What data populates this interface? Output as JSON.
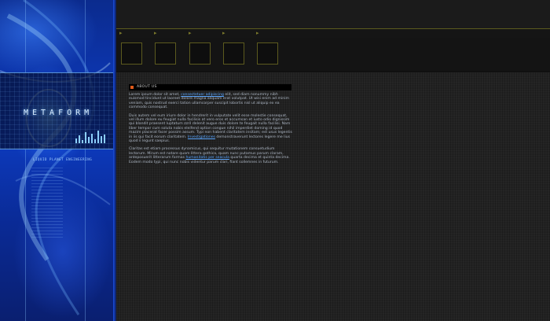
{
  "brand": {
    "logo_text": "METAFORM",
    "tagline": "LIQUID PLANET ENGINEERING"
  },
  "nav": {
    "arrow_count": 5
  },
  "thumbnails": {
    "count": 5
  },
  "section": {
    "title": "About us"
  },
  "content": {
    "p1_a": "Lorem ipsum dolor sit amet, ",
    "p1_link": "consectetuer adipiscing",
    "p1_b": " elit, sed diam nonummy nibh euismod tincidunt ut laoreet dolore magna aliquam erat volutpat. Ut wisi enim ad minim veniam, quis nostrud exerci tation ullamcorper suscipit lobortis nisl ut aliquip ex ea commodo consequat.",
    "p2_a": "Duis autem vel eum iriure dolor in hendrerit in vulputate velit esse molestie consequat, vel illum dolore eu feugiat nulla facilisis at vero eros et accumsan et iusto odio dignissim qui blandit praesent luptatum zzril delenit augue duis dolore te feugait nulla facilisi. Nam liber tempor cum soluta nobis eleifend option congue nihil imperdiet doming id quod mazim placerat facer possim assum. Typi non habent claritatem insitam; est usus legentis in iis qui facit eorum claritatem. ",
    "p2_link": "Investigationes",
    "p2_b": " demonstraverunt lectores legere me lius quod ii legunt saepius.",
    "p3_a": "Claritas est etiam processus dynamicus, qui sequitur mutationem consuetudium lectorum. Mirum est notare quam littera gothica, quam nunc putamus parum claram, anteposuerit litterarum formas ",
    "p3_link": "humanitatis per seacula",
    "p3_b": " quarta decima et quinta decima. Eodem modo typi, qui nunc nobis videntur parum clari, fiant sollemnes in futurum."
  },
  "colors": {
    "accent_blue": "#0d3cc2",
    "link": "#5aa6ff",
    "olive_border": "#5c5a1e",
    "bullet": "#e05a1a"
  }
}
